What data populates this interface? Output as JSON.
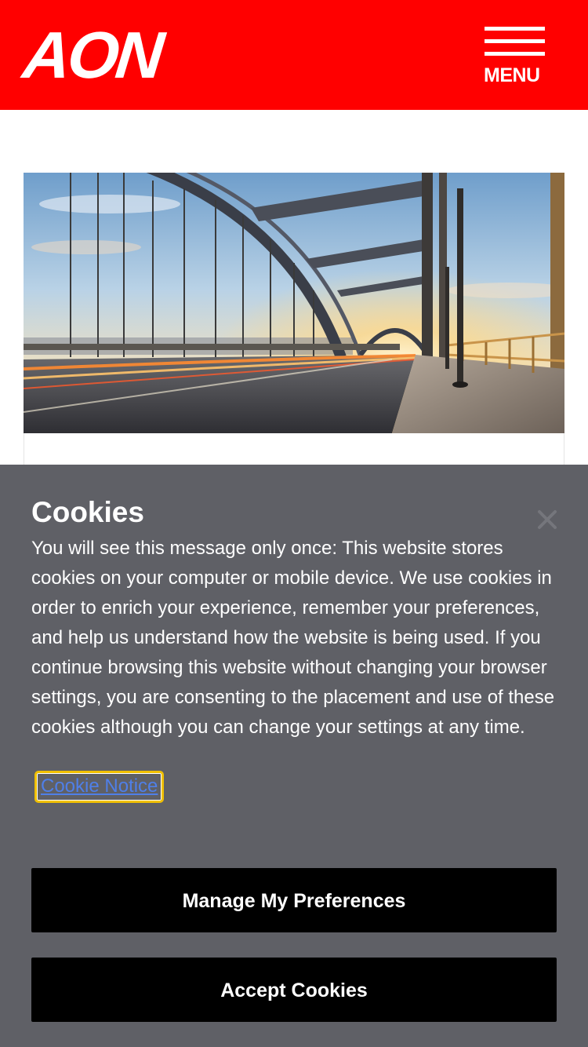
{
  "header": {
    "logo_text": "AON",
    "menu_label": "MENU",
    "background_color": "#ff0000"
  },
  "hero": {
    "image_subject": "bridge-at-sunset"
  },
  "cookie_banner": {
    "title": "Cookies",
    "close_icon": "close-icon",
    "body": "You will see this message only once: This website stores cookies on your computer or mobile device. We use cookies in order to enrich your experience, remember your preferences, and help us understand how the website is being used. If you continue browsing this website without changing your browser settings, you are consenting to the placement and use of these cookies although you can change your settings at any time.",
    "link_label": "Cookie Notice",
    "manage_button_label": "Manage My Preferences",
    "accept_button_label": "Accept Cookies",
    "background_color": "#5f6066",
    "link_focus_color": "#f0c000"
  }
}
